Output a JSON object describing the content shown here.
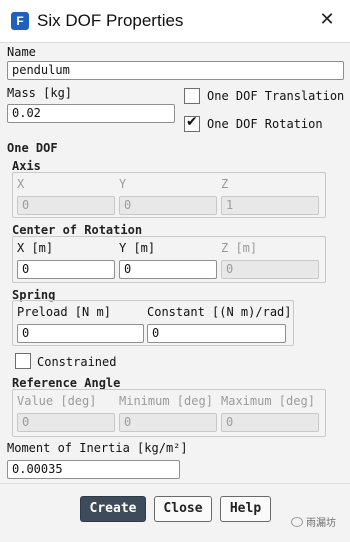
{
  "window": {
    "title": "Six DOF Properties",
    "app_icon_letter": "F",
    "close_glyph": "✕"
  },
  "name": {
    "label": "Name",
    "value": "pendulum"
  },
  "mass": {
    "label": "Mass [kg]",
    "value": "0.02"
  },
  "options": {
    "translation": {
      "label": "One DOF Translation",
      "checked": false
    },
    "rotation": {
      "label": "One DOF Rotation",
      "checked": true
    }
  },
  "one_dof": {
    "heading": "One DOF",
    "axis": {
      "heading": "Axis",
      "labels": [
        "X",
        "Y",
        "Z"
      ],
      "values": [
        "0",
        "0",
        "1"
      ]
    },
    "center": {
      "heading": "Center of Rotation",
      "labels": [
        "X [m]",
        "Y [m]",
        "Z [m]"
      ],
      "values": [
        "0",
        "0",
        "0"
      ]
    },
    "spring": {
      "heading": "Spring",
      "preload_label": "Preload [N m]",
      "preload_value": "0",
      "constant_label": "Constant [(N m)/rad]",
      "constant_value": "0"
    },
    "constrained": {
      "label": "Constrained",
      "checked": false
    },
    "reference_angle": {
      "heading": "Reference Angle",
      "labels": [
        "Value [deg]",
        "Minimum [deg]",
        "Maximum [deg]"
      ],
      "values": [
        "0",
        "0",
        "0"
      ]
    }
  },
  "inertia": {
    "label": "Moment of Inertia [kg/m²]",
    "value": "0.00035"
  },
  "buttons": {
    "create": "Create",
    "close": "Close",
    "help": "Help"
  },
  "watermark": {
    "text": "雨漏坊"
  }
}
